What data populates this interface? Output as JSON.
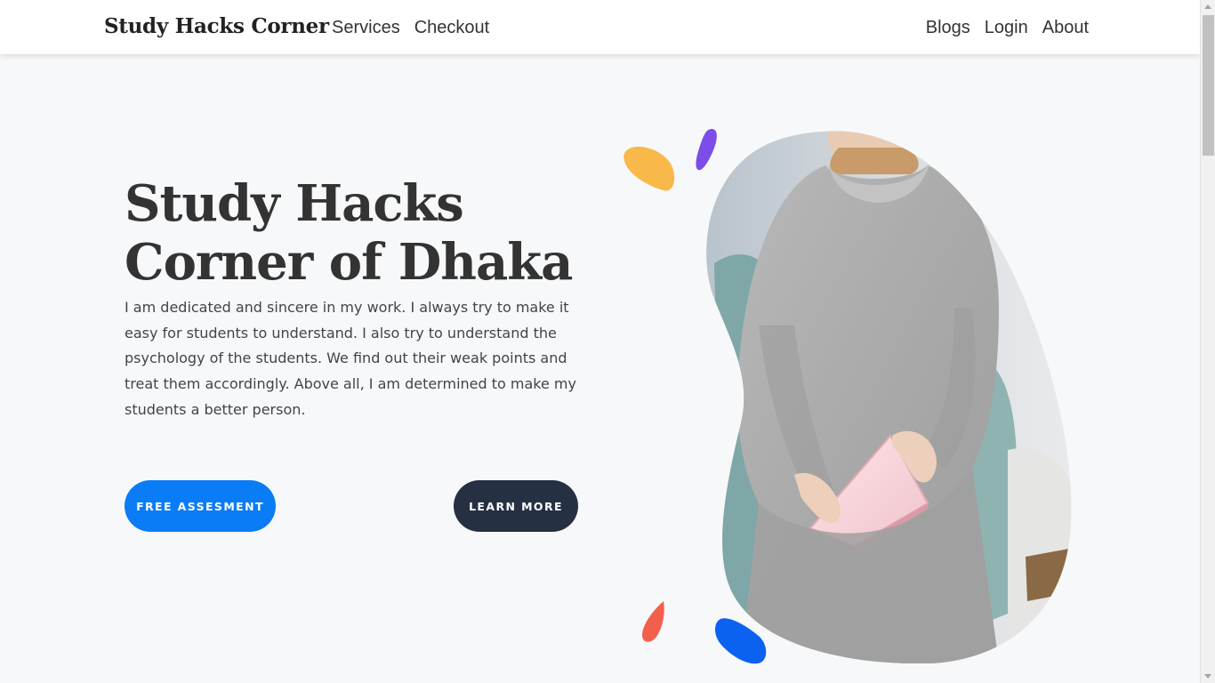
{
  "navbar": {
    "brand": "Study Hacks Corner",
    "left_links": [
      "Services",
      "Checkout"
    ],
    "right_links": [
      "Blogs",
      "Login",
      "About"
    ]
  },
  "hero": {
    "title_line1": "Study Hacks",
    "title_line2": "Corner of Dhaka",
    "description": "I am dedicated and sincere in my work. I always try to make it easy for students to understand. I also try to understand the psychology of the students. We find out their weak points and treat them accordingly. Above all, I am determined to make my students a better person.",
    "primary_button": "FREE ASSESMENT",
    "secondary_button": "LEARN MORE"
  },
  "colors": {
    "primary": "#0a7cf6",
    "dark": "#253142",
    "drop_yellow": "#f9b84a",
    "drop_purple": "#7c4de8",
    "drop_red": "#f2604b",
    "drop_blue": "#0b62f0"
  },
  "icons": [
    "yellow-drop-icon",
    "purple-drop-icon",
    "red-drop-icon",
    "blue-drop-icon"
  ]
}
